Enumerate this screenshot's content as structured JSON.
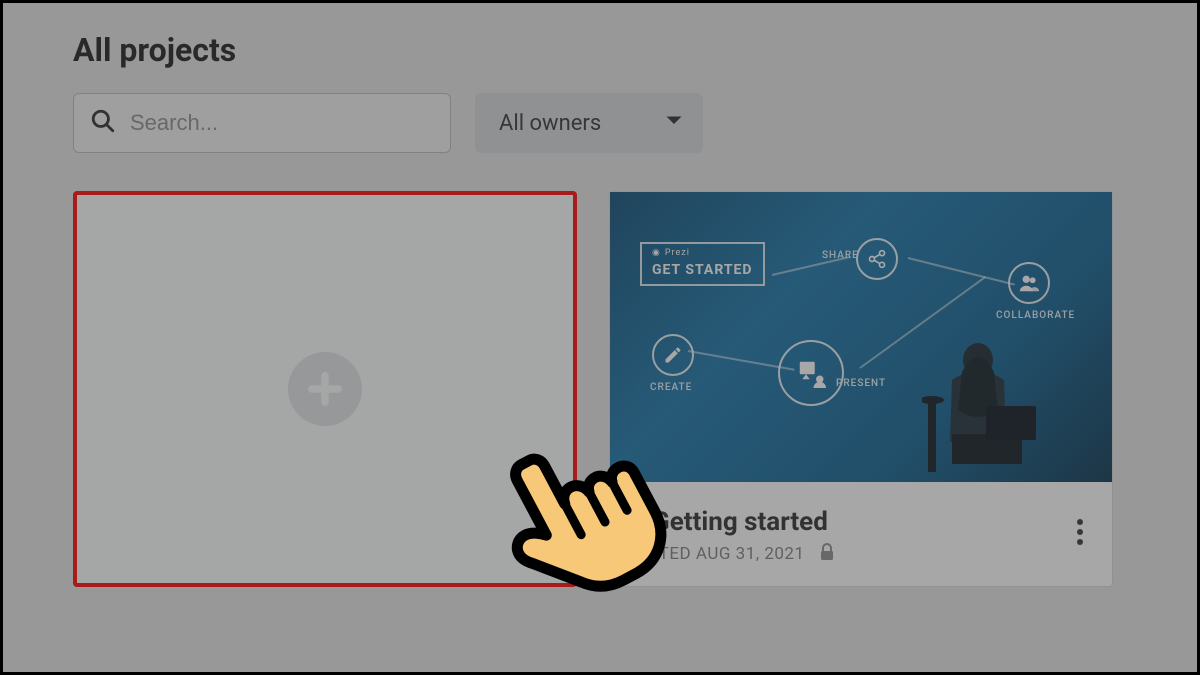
{
  "header": {
    "title": "All projects"
  },
  "search": {
    "placeholder": "Search..."
  },
  "filter": {
    "owners_label": "All owners"
  },
  "thumb": {
    "badge_top": "Prezi",
    "badge_mid": "GET STARTED",
    "node_share": "SHARE",
    "node_collab": "COLLABORATE",
    "node_create": "CREATE",
    "node_present": "PRESENT"
  },
  "project": {
    "title": "Getting started",
    "edited_label": "EDITED AUG 31, 2021"
  }
}
